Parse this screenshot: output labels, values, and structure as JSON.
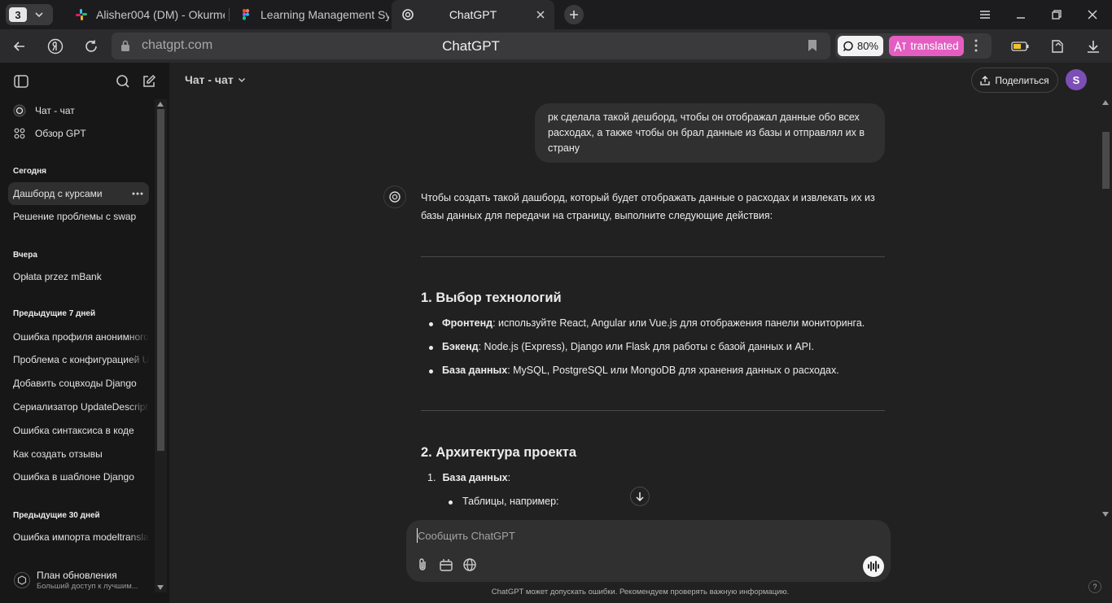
{
  "browser": {
    "tab_count": "3",
    "tabs": [
      {
        "title": "Alisher004 (DM) - Okurmen",
        "icon": "slack-icon"
      },
      {
        "title": "Learning Management Sys",
        "icon": "figma-icon"
      },
      {
        "title": "ChatGPT",
        "icon": "openai-icon"
      }
    ],
    "address": {
      "domain": "chatgpt.com",
      "page_title": "ChatGPT"
    },
    "zoom": "80%",
    "translate_label": "translated",
    "colors": {
      "translate_pill": "#e45ec2",
      "avatar": "#7b4fb6"
    }
  },
  "sidebar": {
    "top_items": [
      {
        "label": "Чат - чат",
        "icon": "openai-icon"
      },
      {
        "label": "Обзор GPT",
        "icon": "grid-icon"
      }
    ],
    "sections": [
      {
        "heading": "Сегодня",
        "items": [
          "Дашборд с курсами",
          "Решение проблемы с swap"
        ]
      },
      {
        "heading": "Вчера",
        "items": [
          "Opłata przez mBank"
        ]
      },
      {
        "heading": "Предыдущие 7 дней",
        "items": [
          "Ошибка профиля анонимного",
          "Проблема с конфигурацией U",
          "Добавить соцвходы Django",
          "Сериализатор UpdateDescripti",
          "Ошибка синтаксиса в коде",
          "Как создать отзывы",
          "Ошибка в шаблоне Django"
        ]
      },
      {
        "heading": "Предыдущие 30 дней",
        "items": [
          "Ошибка импорта modeltransla"
        ]
      }
    ],
    "upgrade": {
      "title": "План обновления",
      "subtitle": "Больший доступ к лучшим..."
    }
  },
  "main": {
    "model": "Чат - чат",
    "share_label": "Поделиться",
    "avatar_letter": "S",
    "user_message": "рк сделала такой дешборд, чтобы он отображал данные обо всех расходах, а также чтобы он брал данные из базы и отправлял их в страну",
    "answer": {
      "intro": "Чтобы создать такой дашборд, который будет отображать данные о расходах и извлекать их из базы данных для передачи на страницу, выполните следующие действия:",
      "section1_title": "1. Выбор технологий",
      "section1_items": [
        {
          "bold": "Фронтенд",
          "text": ": используйте React, Angular или Vue.js для отображения панели мониторинга."
        },
        {
          "bold": "Бэкенд",
          "text": ": Node.js (Express), Django или Flask для работы с базой данных и API."
        },
        {
          "bold": "База данных",
          "text": ": MySQL, PostgreSQL или MongoDB для хранения данных о расходах."
        }
      ],
      "section2_title": "2. Архитектура проекта",
      "section2_item_num": "1.",
      "section2_item_bold": "База данных",
      "section2_item_text": ":",
      "section2_sub": "Таблицы, например:"
    },
    "composer_placeholder": "Сообщить ChatGPT",
    "disclaimer": "ChatGPT может допускать ошибки. Рекомендуем проверять важную информацию.",
    "help": "?"
  }
}
